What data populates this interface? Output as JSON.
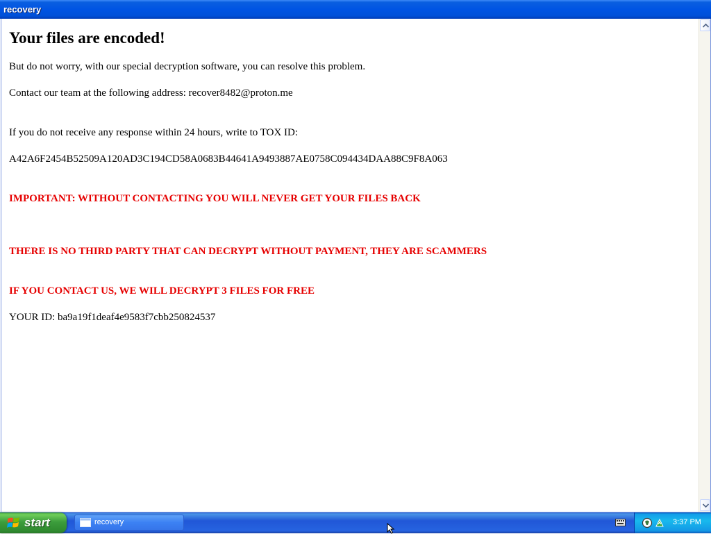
{
  "window": {
    "title": "recovery"
  },
  "note": {
    "heading": "Your files are encoded!",
    "line1": "But do not worry, with our special decryption software, you can resolve this problem.",
    "line2": "Contact our team at the following address: recover8482@proton.me",
    "line3": "If you do not receive any response within 24 hours, write to TOX ID:",
    "tox_id": "A42A6F2454B52509A120AD3C194CD58A0683B44641A9493887AE0758C094434DAA88C9F8A063",
    "warning1": "IMPORTANT: WITHOUT CONTACTING YOU WILL NEVER GET YOUR FILES BACK",
    "warning2": "THERE IS NO THIRD PARTY THAT CAN DECRYPT WITHOUT PAYMENT, THEY ARE SCAMMERS",
    "warning3": "IF YOU CONTACT US, WE WILL DECRYPT 3 FILES FOR FREE",
    "your_id": "YOUR ID: ba9a19f1deaf4e9583f7cbb250824537"
  },
  "taskbar": {
    "start_label": "start",
    "task_label": "recovery",
    "clock": "3:37 PM"
  },
  "icons": {
    "start": "windows-flag-icon",
    "task": "window-icon",
    "keyboard": "keyboard-icon",
    "tray1": "network-icon",
    "tray2": "security-icon",
    "cursor": "mouse-cursor-icon"
  },
  "colors": {
    "warning": "#e60000",
    "titlebar": "#0054e3",
    "taskbar": "#2157d7",
    "start": "#3c9d3c",
    "tray": "#18b9ed"
  }
}
